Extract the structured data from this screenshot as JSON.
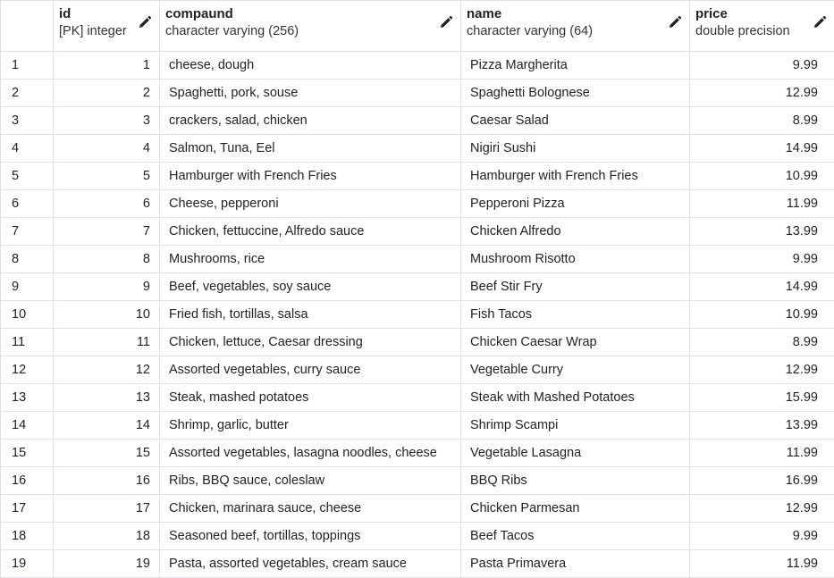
{
  "columns": {
    "id": {
      "title": "id",
      "type": "[PK] integer"
    },
    "compound": {
      "title": "compaund",
      "type": "character varying (256)"
    },
    "name": {
      "title": "name",
      "type": "character varying (64)"
    },
    "price": {
      "title": "price",
      "type": "double precision"
    }
  },
  "icons": {
    "edit": "pencil-icon"
  },
  "rows": [
    {
      "rownum": "1",
      "id": "1",
      "compound": "cheese, dough",
      "name": "Pizza Margherita",
      "price": "9.99"
    },
    {
      "rownum": "2",
      "id": "2",
      "compound": "Spaghetti, pork, souse",
      "name": "Spaghetti Bolognese",
      "price": "12.99"
    },
    {
      "rownum": "3",
      "id": "3",
      "compound": "crackers, salad, chicken",
      "name": "Caesar Salad",
      "price": "8.99"
    },
    {
      "rownum": "4",
      "id": "4",
      "compound": "Salmon, Tuna, Eel",
      "name": "Nigiri Sushi",
      "price": "14.99"
    },
    {
      "rownum": "5",
      "id": "5",
      "compound": "Hamburger with French Fries",
      "name": "Hamburger with French Fries",
      "price": "10.99"
    },
    {
      "rownum": "6",
      "id": "6",
      "compound": "Cheese, pepperoni",
      "name": "Pepperoni Pizza",
      "price": "11.99"
    },
    {
      "rownum": "7",
      "id": "7",
      "compound": "Chicken, fettuccine, Alfredo sauce",
      "name": "Chicken Alfredo",
      "price": "13.99"
    },
    {
      "rownum": "8",
      "id": "8",
      "compound": "Mushrooms, rice",
      "name": "Mushroom Risotto",
      "price": "9.99"
    },
    {
      "rownum": "9",
      "id": "9",
      "compound": "Beef, vegetables, soy sauce",
      "name": "Beef Stir Fry",
      "price": "14.99"
    },
    {
      "rownum": "10",
      "id": "10",
      "compound": "Fried fish, tortillas, salsa",
      "name": "Fish Tacos",
      "price": "10.99"
    },
    {
      "rownum": "11",
      "id": "11",
      "compound": "Chicken, lettuce, Caesar dressing",
      "name": "Chicken Caesar Wrap",
      "price": "8.99"
    },
    {
      "rownum": "12",
      "id": "12",
      "compound": "Assorted vegetables, curry sauce",
      "name": "Vegetable Curry",
      "price": "12.99"
    },
    {
      "rownum": "13",
      "id": "13",
      "compound": "Steak, mashed potatoes",
      "name": "Steak with Mashed Potatoes",
      "price": "15.99"
    },
    {
      "rownum": "14",
      "id": "14",
      "compound": "Shrimp, garlic, butter",
      "name": "Shrimp Scampi",
      "price": "13.99"
    },
    {
      "rownum": "15",
      "id": "15",
      "compound": "Assorted vegetables, lasagna noodles, cheese",
      "name": "Vegetable Lasagna",
      "price": "11.99"
    },
    {
      "rownum": "16",
      "id": "16",
      "compound": "Ribs, BBQ sauce, coleslaw",
      "name": "BBQ Ribs",
      "price": "16.99"
    },
    {
      "rownum": "17",
      "id": "17",
      "compound": "Chicken, marinara sauce, cheese",
      "name": "Chicken Parmesan",
      "price": "12.99"
    },
    {
      "rownum": "18",
      "id": "18",
      "compound": "Seasoned beef, tortillas, toppings",
      "name": "Beef Tacos",
      "price": "9.99"
    },
    {
      "rownum": "19",
      "id": "19",
      "compound": "Pasta, assorted vegetables, cream sauce",
      "name": "Pasta Primavera",
      "price": "11.99"
    }
  ]
}
